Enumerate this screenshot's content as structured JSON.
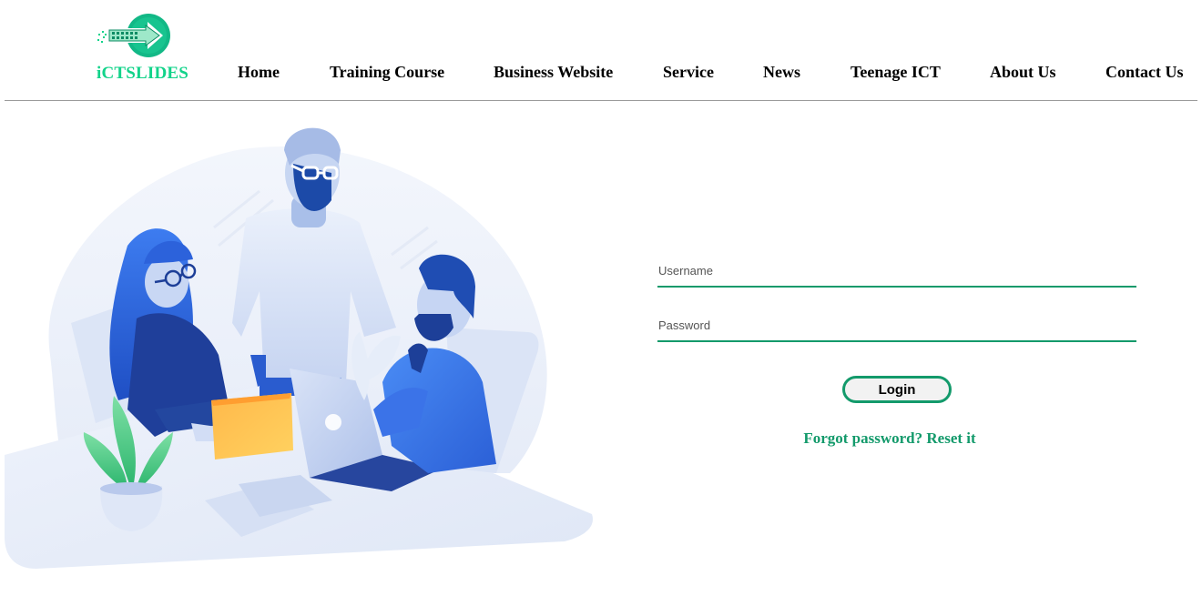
{
  "brand": {
    "name": "iCTSLIDES",
    "accent": "#12d38a",
    "dark_accent": "#139a6b",
    "logo_icon": "keyboard-arrow-logo"
  },
  "nav": {
    "items": [
      {
        "label": "Home"
      },
      {
        "label": "Training Course"
      },
      {
        "label": "Business Website"
      },
      {
        "label": "Service"
      },
      {
        "label": "News"
      },
      {
        "label": "Teenage ICT"
      },
      {
        "label": "About Us"
      },
      {
        "label": "Contact Us"
      }
    ]
  },
  "login": {
    "username_placeholder": "Username",
    "username_value": "",
    "password_placeholder": "Password",
    "password_value": "",
    "button_label": "Login",
    "forgot_text": "Forgot password? Reset it"
  },
  "illustration": {
    "name": "team-meeting-illustration"
  }
}
